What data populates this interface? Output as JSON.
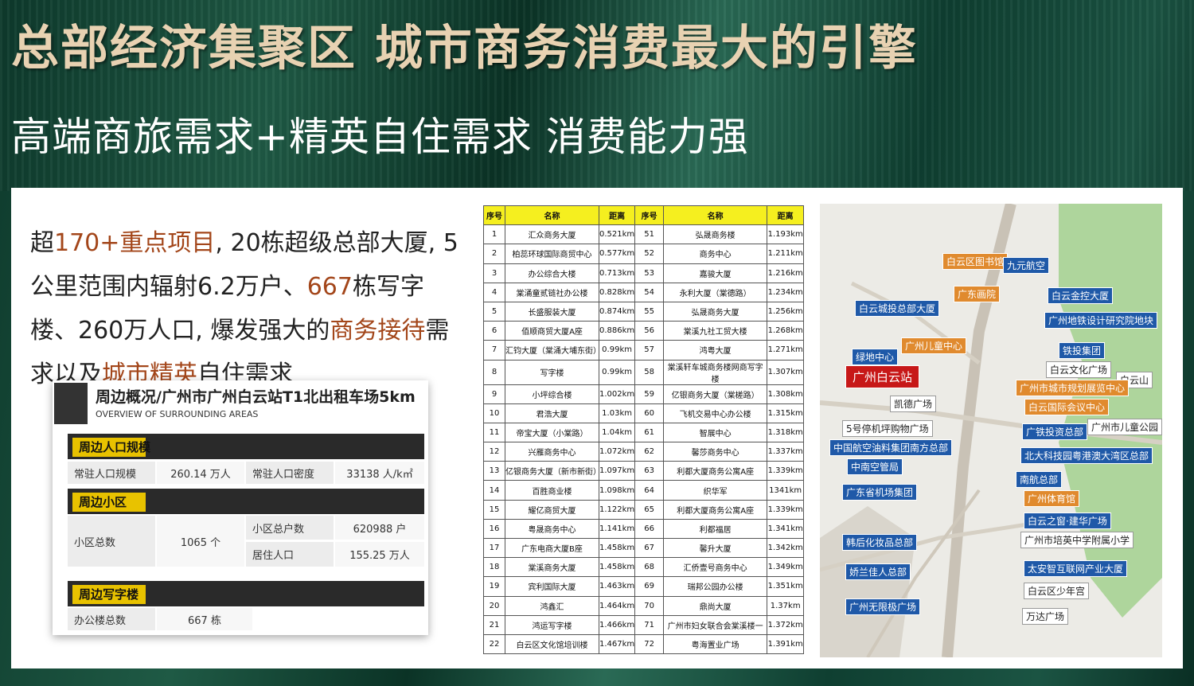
{
  "title": "总部经济集聚区 城市商务消费最大的引擎",
  "subtitle": "高端商旅需求+精英自住需求  消费能力强",
  "intro": {
    "p1": "超",
    "h1": "170+重点项目",
    "p2": ", ",
    "h2": "20栋超级总部大厦",
    "p3": ", 5公里范围内辐射6.2万户、",
    "h3": "667",
    "p4": "栋写字楼、260万人口, 爆发强大的",
    "h4": "商务接待",
    "p5": "需求以及",
    "h5": "城市精英",
    "p6": "自住需求"
  },
  "overview": {
    "title": "周边概况/广州市广州白云站T1北出租车场5km",
    "subtitle": "OVERVIEW OF SURROUNDING AREAS",
    "population": {
      "header": "周边人口规模",
      "pop_label": "常驻人口规模",
      "pop_value": "260.14 万人",
      "density_label": "常驻人口密度",
      "density_value": "33138 人/k㎡"
    },
    "community": {
      "header": "周边小区",
      "total_label": "小区总数",
      "total_value": "1065 个",
      "households_label": "小区总户数",
      "households_value": "620988 户",
      "residents_label": "居住人口",
      "residents_value": "155.25 万人"
    },
    "office": {
      "header": "周边写字楼",
      "count_label": "办公楼总数",
      "count_value": "667 栋"
    }
  },
  "table": {
    "headers": [
      "序号",
      "名称",
      "距离",
      "序号",
      "名称",
      "距离"
    ],
    "rows": [
      [
        "1",
        "汇众商务大厦",
        "0.521km",
        "51",
        "弘晟商务楼",
        "1.193km"
      ],
      [
        "2",
        "柏蕊环球国际商贸中心",
        "0.577km",
        "52",
        "商务中心",
        "1.211km"
      ],
      [
        "3",
        "办公综合大楼",
        "0.713km",
        "53",
        "嘉骏大厦",
        "1.216km"
      ],
      [
        "4",
        "棠涌童贰链社办公楼",
        "0.828km",
        "54",
        "永利大厦（棠德路）",
        "1.234km"
      ],
      [
        "5",
        "长盛服装大厦",
        "0.874km",
        "55",
        "弘晟商务大厦",
        "1.256km"
      ],
      [
        "6",
        "佰顺商贸大厦A座",
        "0.886km",
        "56",
        "棠溪九社工贸大楼",
        "1.268km"
      ],
      [
        "7",
        "汇钧大厦（棠涌大埔东街）",
        "0.99km",
        "57",
        "鸿粤大厦",
        "1.271km"
      ],
      [
        "8",
        "写字楼",
        "0.99km",
        "58",
        "棠溪轩车城商务楼网商写字楼",
        "1.307km"
      ],
      [
        "9",
        "小坪综合楼",
        "1.002km",
        "59",
        "亿银商务大厦（棠槎路）",
        "1.308km"
      ],
      [
        "10",
        "君浩大厦",
        "1.03km",
        "60",
        "飞机交易中心办公楼",
        "1.315km"
      ],
      [
        "11",
        "帝宝大厦（小棠路）",
        "1.04km",
        "61",
        "智展中心",
        "1.318km"
      ],
      [
        "12",
        "兴雁商务中心",
        "1.072km",
        "62",
        "馨莎商务中心",
        "1.337km"
      ],
      [
        "13",
        "亿银商务大厦（新市新街）",
        "1.097km",
        "63",
        "利都大厦商务公寓A座",
        "1.339km"
      ],
      [
        "14",
        "百胜商业楼",
        "1.098km",
        "64",
        "织华军",
        "1341km"
      ],
      [
        "15",
        "耀亿商贸大厦",
        "1.122km",
        "65",
        "利都大厦商务公寓A座",
        "1.339km"
      ],
      [
        "16",
        "粤晟商务中心",
        "1.141km",
        "66",
        "利都福居",
        "1.341km"
      ],
      [
        "17",
        "广东电商大厦B座",
        "1.458km",
        "67",
        "馨升大厦",
        "1.342km"
      ],
      [
        "18",
        "棠溪商务大厦",
        "1.458km",
        "68",
        "汇侨壹号商务中心",
        "1.349km"
      ],
      [
        "19",
        "宾利国际大厦",
        "1.463km",
        "69",
        "瑞邦公园办公楼",
        "1.351km"
      ],
      [
        "20",
        "鸿鑫汇",
        "1.464km",
        "70",
        "鼎尚大厦",
        "1.37km"
      ],
      [
        "21",
        "鸿运写字楼",
        "1.466km",
        "71",
        "广州市妇女联合会棠溪楼一",
        "1.372km"
      ],
      [
        "22",
        "白云区文化馆培训楼",
        "1.467km",
        "72",
        "粤海置业广场",
        "1.391km"
      ]
    ]
  },
  "map": {
    "center": "广州白云站",
    "labels_blue": [
      "九元航空",
      "白云金控大厦",
      "白云城投总部大厦",
      "广州地铁设计研究院地块",
      "铁投集团",
      "绿地中心",
      "中国航空油料集团南方总部",
      "中南空管局",
      "广东省机场集团",
      "广铁投资总部",
      "北大科技园粤港澳大湾区总部",
      "南航总部",
      "白云之窗·建华广场",
      "韩后化妆品总部",
      "太安智互联网产业大厦",
      "娇兰佳人总部",
      "广州无限极广场"
    ],
    "labels_orange": [
      "白云区图书馆",
      "广东画院",
      "广州儿童中心",
      "广州市城市规划展览中心",
      "白云国际会议中心",
      "广州体育馆"
    ],
    "labels_white": [
      "凯德广场",
      "5号停机坪购物广场",
      "白云文化广场",
      "白云山",
      "广州市儿童公园",
      "广州市培英中学附属小学",
      "白云区少年宫",
      "万达广场"
    ]
  }
}
